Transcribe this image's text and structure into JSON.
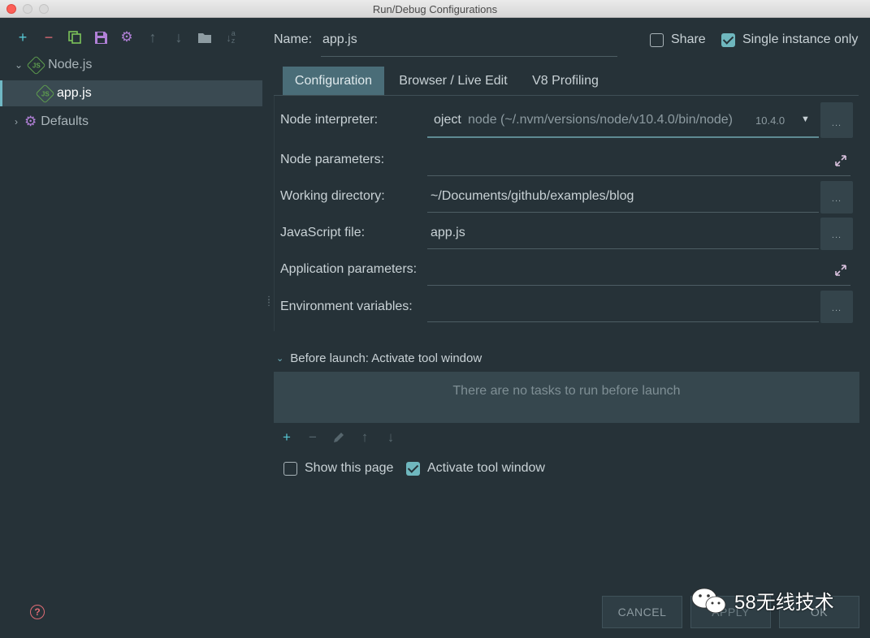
{
  "window": {
    "title": "Run/Debug Configurations"
  },
  "tree": {
    "group_label": "Node.js",
    "selected_item": "app.js",
    "defaults_label": "Defaults"
  },
  "form": {
    "name_label": "Name:",
    "name_value": "app.js",
    "share_label": "Share",
    "single_instance_label": "Single instance only",
    "tabs": [
      "Configuration",
      "Browser / Live Edit",
      "V8 Profiling"
    ],
    "node_interpreter_label": "Node interpreter:",
    "node_interpreter_prefix": "oject",
    "node_interpreter_path": "node (~/.nvm/versions/node/v10.4.0/bin/node)",
    "node_interpreter_version": "10.4.0",
    "node_parameters_label": "Node parameters:",
    "working_directory_label": "Working directory:",
    "working_directory_value": "~/Documents/github/examples/blog",
    "javascript_file_label": "JavaScript file:",
    "javascript_file_value": "app.js",
    "application_parameters_label": "Application parameters:",
    "environment_variables_label": "Environment variables:",
    "ellipsis": "..."
  },
  "before_launch": {
    "header": "Before launch: Activate tool window",
    "empty_text": "There are no tasks to run before launch",
    "show_this_page_label": "Show this page",
    "activate_tool_window_label": "Activate tool window"
  },
  "footer": {
    "cancel_label": "CANCEL",
    "apply_label": "APPLY",
    "ok_label": "OK",
    "watermark_text": "58无线技术"
  },
  "colors": {
    "background": "#263238",
    "accent": "#70b8c4",
    "node_green": "#5fa04e",
    "settings_purple": "#b180d7",
    "remove_red": "#e06c75"
  }
}
